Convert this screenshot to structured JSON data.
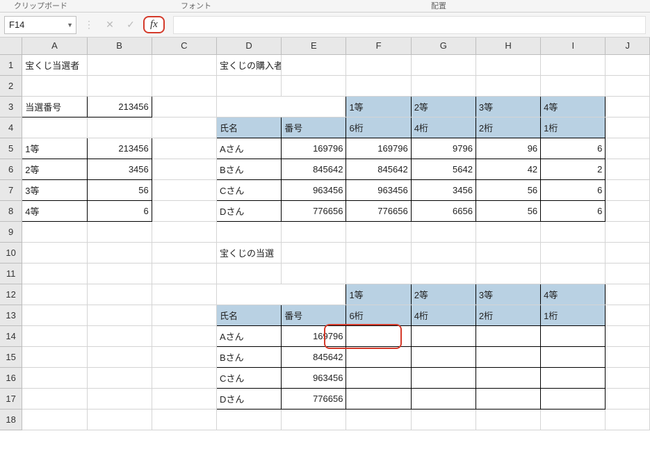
{
  "ribbon": {
    "clipboard": "クリップボード",
    "font": "フォント",
    "align": "配置"
  },
  "nameBox": "F14",
  "fxLabel": "fx",
  "columns": [
    "A",
    "B",
    "C",
    "D",
    "E",
    "F",
    "G",
    "H",
    "I",
    "J"
  ],
  "rowCount": 18,
  "labels": {
    "lotteryWinners": "宝くじ当選者",
    "winningNumber": "当選番号",
    "lotteryBuyers": "宝くじの購入者",
    "name": "氏名",
    "number": "番号",
    "lotteryWin": "宝くじの当選"
  },
  "winNum": 213456,
  "prizeRows": [
    {
      "prize": "1等",
      "val": 213456
    },
    {
      "prize": "2等",
      "val": 3456
    },
    {
      "prize": "3等",
      "val": 56
    },
    {
      "prize": "4等",
      "val": 6
    }
  ],
  "prizeCols": [
    "1等",
    "2等",
    "3等",
    "4等"
  ],
  "digitCols": [
    "6桁",
    "4桁",
    "2桁",
    "1桁"
  ],
  "buyers": [
    {
      "name": "Aさん",
      "num": 169796,
      "d6": 169796,
      "d4": 9796,
      "d2": 96,
      "d1": 6
    },
    {
      "name": "Bさん",
      "num": 845642,
      "d6": 845642,
      "d4": 5642,
      "d2": 42,
      "d1": 2
    },
    {
      "name": "Cさん",
      "num": 963456,
      "d6": 963456,
      "d4": 3456,
      "d2": 56,
      "d1": 6
    },
    {
      "name": "Dさん",
      "num": 776656,
      "d6": 776656,
      "d4": 6656,
      "d2": 56,
      "d1": 6
    }
  ],
  "buyers2": [
    {
      "name": "Aさん",
      "num": 169796
    },
    {
      "name": "Bさん",
      "num": 845642
    },
    {
      "name": "Cさん",
      "num": 963456
    },
    {
      "name": "Dさん",
      "num": 776656
    }
  ]
}
